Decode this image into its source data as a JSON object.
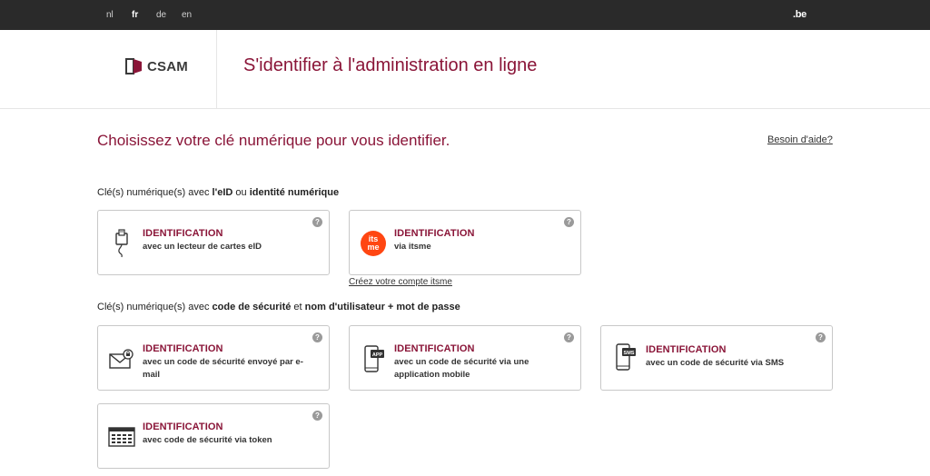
{
  "topbar": {
    "languages": [
      {
        "code": "nl",
        "active": false
      },
      {
        "code": "fr",
        "active": true
      },
      {
        "code": "de",
        "active": false
      },
      {
        "code": "en",
        "active": false
      }
    ],
    "be_logo": ".be"
  },
  "header": {
    "logo_text": "CSAM",
    "title": "S'identifier à l'administration en ligne"
  },
  "main": {
    "title": "Choisissez votre clé numérique pour vous identifier.",
    "help_link": "Besoin d'aide?"
  },
  "section1": {
    "label_prefix": "Clé(s) numérique(s) avec ",
    "label_b1": "l'eID",
    "label_mid": " ou ",
    "label_b2": "identité numérique"
  },
  "section2": {
    "label_prefix": "Clé(s) numérique(s) avec ",
    "label_b1": "code de sécurité",
    "label_mid": " et ",
    "label_b2": "nom d'utilisateur + mot de passe"
  },
  "cards": {
    "eid": {
      "title": "IDENTIFICATION",
      "subtitle": "avec un lecteur de cartes eID",
      "icon": "card-reader-icon"
    },
    "itsme": {
      "title": "IDENTIFICATION",
      "subtitle": "via itsme",
      "icon": "itsme-logo",
      "logo_line1": "its",
      "logo_line2": "me"
    },
    "email": {
      "title": "IDENTIFICATION",
      "subtitle": "avec un code de sécurité envoyé par e-mail",
      "icon": "envelope-icon"
    },
    "app": {
      "title": "IDENTIFICATION",
      "subtitle": "avec un code de sécurité via une application mobile",
      "icon": "phone-app-icon",
      "badge": "APP"
    },
    "sms": {
      "title": "IDENTIFICATION",
      "subtitle": "avec un code de sécurité via SMS",
      "icon": "phone-sms-icon",
      "badge": "SMS"
    },
    "token": {
      "title": "IDENTIFICATION",
      "subtitle": "avec code de sécurité via token",
      "icon": "token-icon"
    }
  },
  "help_icon_glyph": "?",
  "itsme_link": "Créez votre compte itsme",
  "colors": {
    "accent": "#8a1538",
    "topbar": "#2a2a2a",
    "itsme": "#ff4612"
  }
}
